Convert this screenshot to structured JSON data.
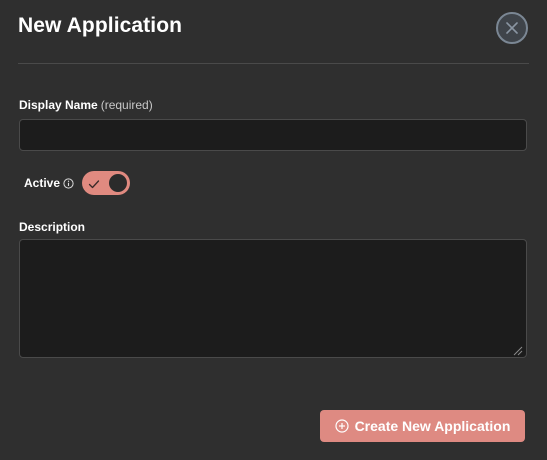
{
  "modal": {
    "title": "New Application",
    "close_icon": "close-icon"
  },
  "display_name": {
    "label": "Display Name",
    "hint": "(required)",
    "value": "",
    "placeholder": ""
  },
  "active": {
    "label": "Active",
    "info_icon": "info-icon",
    "toggle_on": true,
    "toggle_icon": "check-icon",
    "accent_color": "#e08a80"
  },
  "description": {
    "label": "Description",
    "value": "",
    "placeholder": ""
  },
  "actions": {
    "create_label": "Create New Application",
    "create_icon": "plus-circle-icon",
    "create_color": "#de8a82"
  }
}
